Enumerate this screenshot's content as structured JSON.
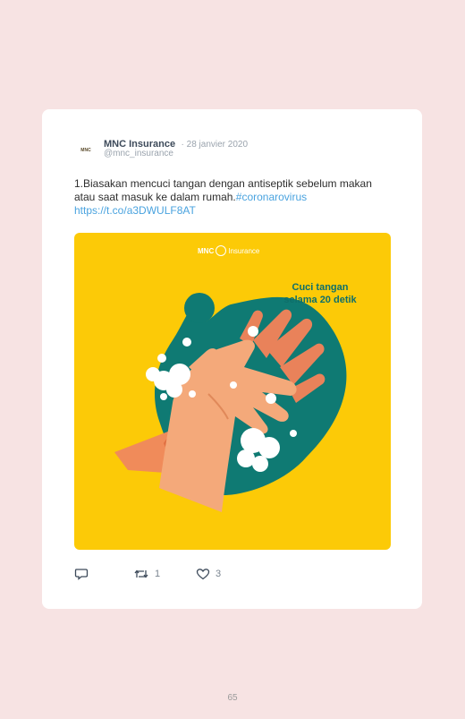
{
  "tweet": {
    "author_name": "MNC Insurance",
    "date": "· 28 janvier 2020",
    "handle": "@mnc_insurance",
    "text_main": "1.Biasakan mencuci tangan dengan antiseptik sebelum makan atau saat masuk ke dalam rumah.",
    "hashtag": "#coronarovirus",
    "link": "https://t.co/a3DWULF8AT",
    "avatar_logo_text": "MNC",
    "media": {
      "brand_name": "MNC",
      "brand_suffix": "Insurance",
      "caption_line1": "Cuci tangan",
      "caption_line2": "selama 20 detik"
    },
    "actions": {
      "reply_icon": "reply-icon",
      "retweet_icon": "retweet-icon",
      "retweet_count": "1",
      "like_icon": "heart-icon",
      "like_count": "3"
    }
  },
  "page_number": "65",
  "colors": {
    "background": "#f7e3e3",
    "media_bg": "#fcca07",
    "blob": "#0f7a73",
    "skin": "#f4a97a",
    "link": "#4aa3df"
  }
}
